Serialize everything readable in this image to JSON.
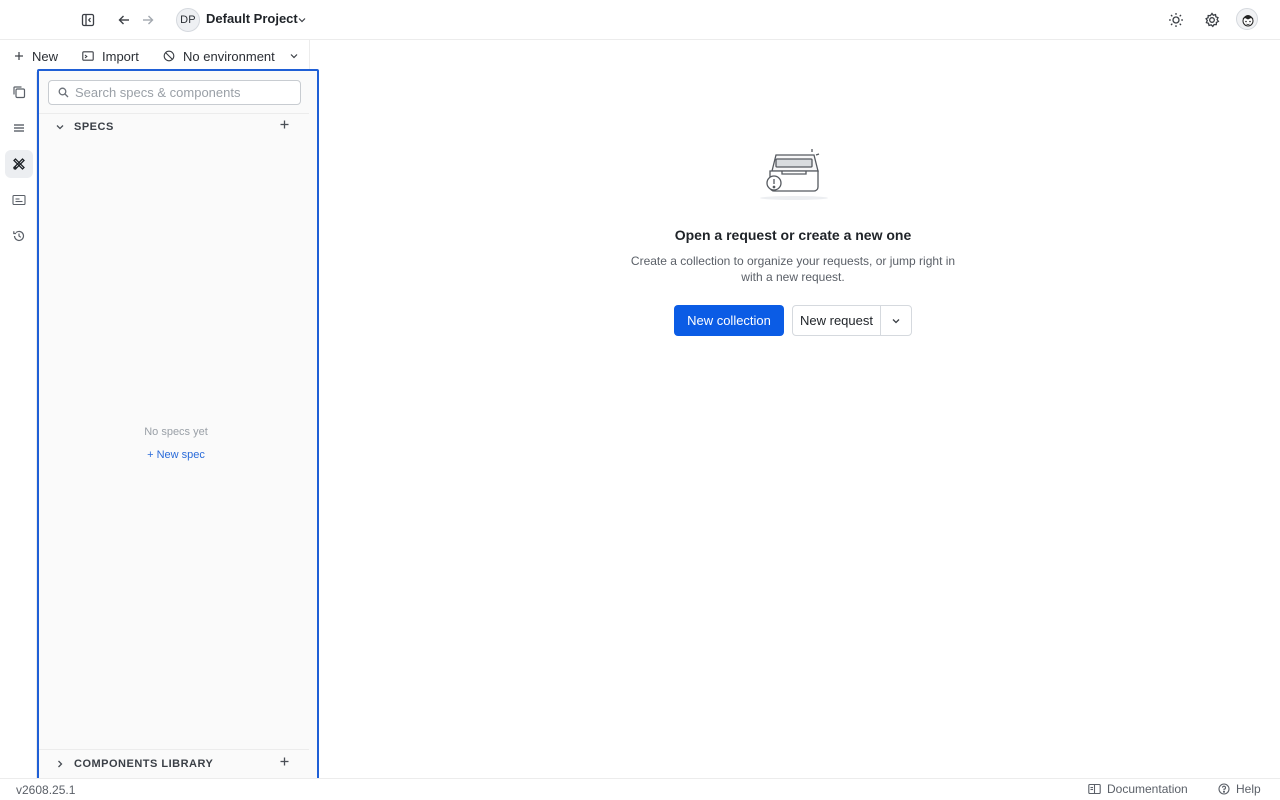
{
  "topbar": {
    "project_initials": "DP",
    "project_name": "Default Project"
  },
  "actions": {
    "new_label": "New",
    "import_label": "Import",
    "environment_label": "No environment"
  },
  "rail": {
    "items": [
      "collections-icon",
      "list-icon",
      "specs-icon",
      "environments-icon",
      "history-icon"
    ],
    "active": "specs-icon"
  },
  "panel": {
    "search_placeholder": "Search specs & components",
    "specs_title": "SPECS",
    "empty_text": "No specs yet",
    "new_spec_link": "+ New spec",
    "components_title": "COMPONENTS LIBRARY"
  },
  "main": {
    "title": "Open a request or create a new one",
    "description": "Create a collection to organize your requests, or jump right in with a new request.",
    "new_collection_label": "New collection",
    "new_request_label": "New request"
  },
  "footer": {
    "version": "v2608.25.1",
    "documentation_label": "Documentation",
    "help_label": "Help"
  },
  "colors": {
    "accent": "#0b5ce5",
    "selection_outline": "#1f5fd6",
    "link": "#2a6bd9"
  }
}
